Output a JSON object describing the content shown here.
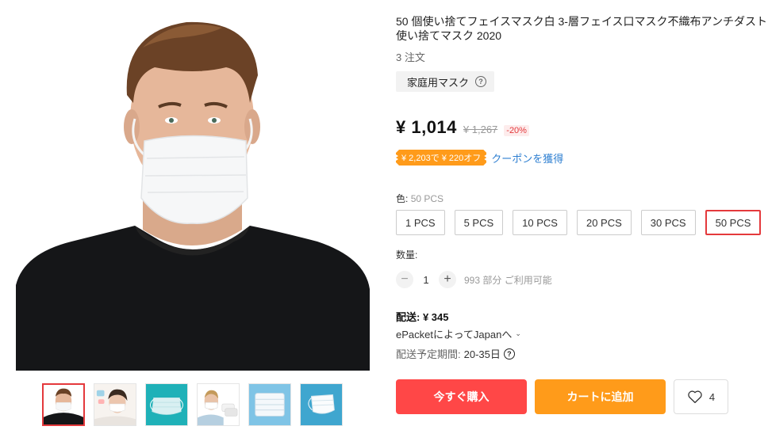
{
  "product": {
    "title": "50 個使い捨てフェイスマスク白 3-層フェイス口マスク不織布アンチダスト使い捨てマスク 2020",
    "orders": "3 注文",
    "tag": "家庭用マスク",
    "price": "¥ 1,014",
    "old_price": "¥ 1,267",
    "discount": "-20%",
    "coupon_badge": "¥ 2,203で ¥ 220オフ",
    "coupon_link": "クーポンを獲得"
  },
  "variant": {
    "label": "色:",
    "selected": "50 PCS",
    "options": [
      "1 PCS",
      "5 PCS",
      "10 PCS",
      "20 PCS",
      "30 PCS",
      "50 PCS"
    ]
  },
  "quantity": {
    "label": "数量:",
    "minus": "−",
    "value": "1",
    "plus": "+",
    "stock": "993 部分 ご利用可能"
  },
  "shipping": {
    "label": "配送: ¥ 345",
    "method": "ePacketによってJapanへ",
    "method_chevron": "⌄",
    "eta_label": "配送予定期間:",
    "eta_value": "20-35日"
  },
  "actions": {
    "buy": "今すぐ購入",
    "cart": "カートに追加",
    "wishlist_count": "4"
  },
  "gallery": {
    "thumbnails": [
      "man-mask",
      "woman-mask",
      "mask-blue",
      "woman-mask-2",
      "mask-stack",
      "mask-single"
    ],
    "active_index": 0
  },
  "colors": {
    "accent_red": "#e4393c",
    "buy_red": "#ff4747",
    "cart_orange": "#ff9b1a",
    "link_blue": "#2e7fd1"
  }
}
